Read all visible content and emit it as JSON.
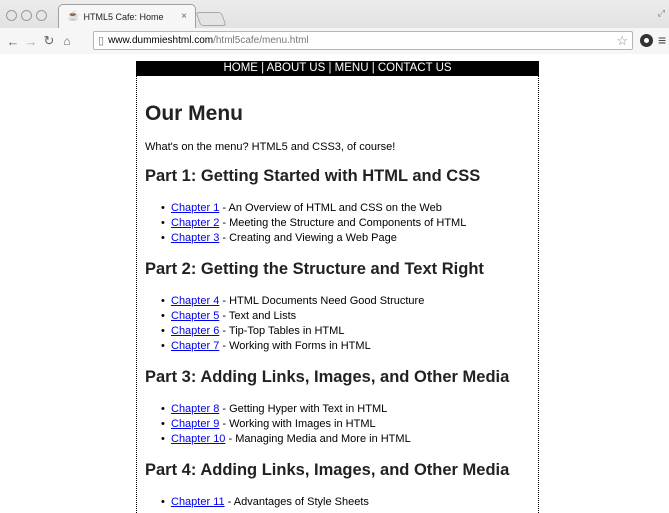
{
  "browser": {
    "tab_title": "HTML5 Cafe: Home",
    "tab_close": "×",
    "url_host": "www.dummieshtml.com",
    "url_path": "/html5cafe/menu.html"
  },
  "page": {
    "navbar": "HOME | ABOUT US | MENU | CONTACT US",
    "title": "Our Menu",
    "intro": "What's on the menu? HTML5 and CSS3, of course!",
    "parts": [
      {
        "heading": "Part 1: Getting Started with HTML and CSS",
        "chapters": [
          {
            "link": "Chapter 1",
            "desc": " - An Overview of HTML and CSS on the Web"
          },
          {
            "link": "Chapter 2",
            "desc": " - Meeting the Structure and Components of HTML"
          },
          {
            "link": "Chapter 3",
            "desc": " - Creating and Viewing a Web Page"
          }
        ]
      },
      {
        "heading": "Part 2: Getting the Structure and Text Right",
        "chapters": [
          {
            "link": "Chapter 4",
            "desc": " - HTML Documents Need Good Structure"
          },
          {
            "link": "Chapter 5",
            "desc": " - Text and Lists"
          },
          {
            "link": "Chapter 6",
            "desc": " - Tip-Top Tables in HTML"
          },
          {
            "link": "Chapter 7",
            "desc": " - Working with Forms in HTML"
          }
        ]
      },
      {
        "heading": "Part 3: Adding Links, Images, and Other Media",
        "chapters": [
          {
            "link": "Chapter 8",
            "desc": " - Getting Hyper with Text in HTML"
          },
          {
            "link": "Chapter 9",
            "desc": " - Working with Images in HTML"
          },
          {
            "link": "Chapter 10",
            "desc": " - Managing Media and More in HTML"
          }
        ]
      },
      {
        "heading": "Part 4: Adding Links, Images, and Other Media",
        "chapters": [
          {
            "link": "Chapter 11",
            "desc": " - Advantages of Style Sheets"
          }
        ]
      }
    ]
  },
  "colors": {
    "link": "#0000ee",
    "navbar_bg": "#000000",
    "navbar_text": "#ffffff"
  },
  "icons": [
    "close-icon",
    "back-icon",
    "forward-icon",
    "reload-icon",
    "home-icon",
    "page-icon",
    "star-icon",
    "extension-icon",
    "menu-icon"
  ]
}
